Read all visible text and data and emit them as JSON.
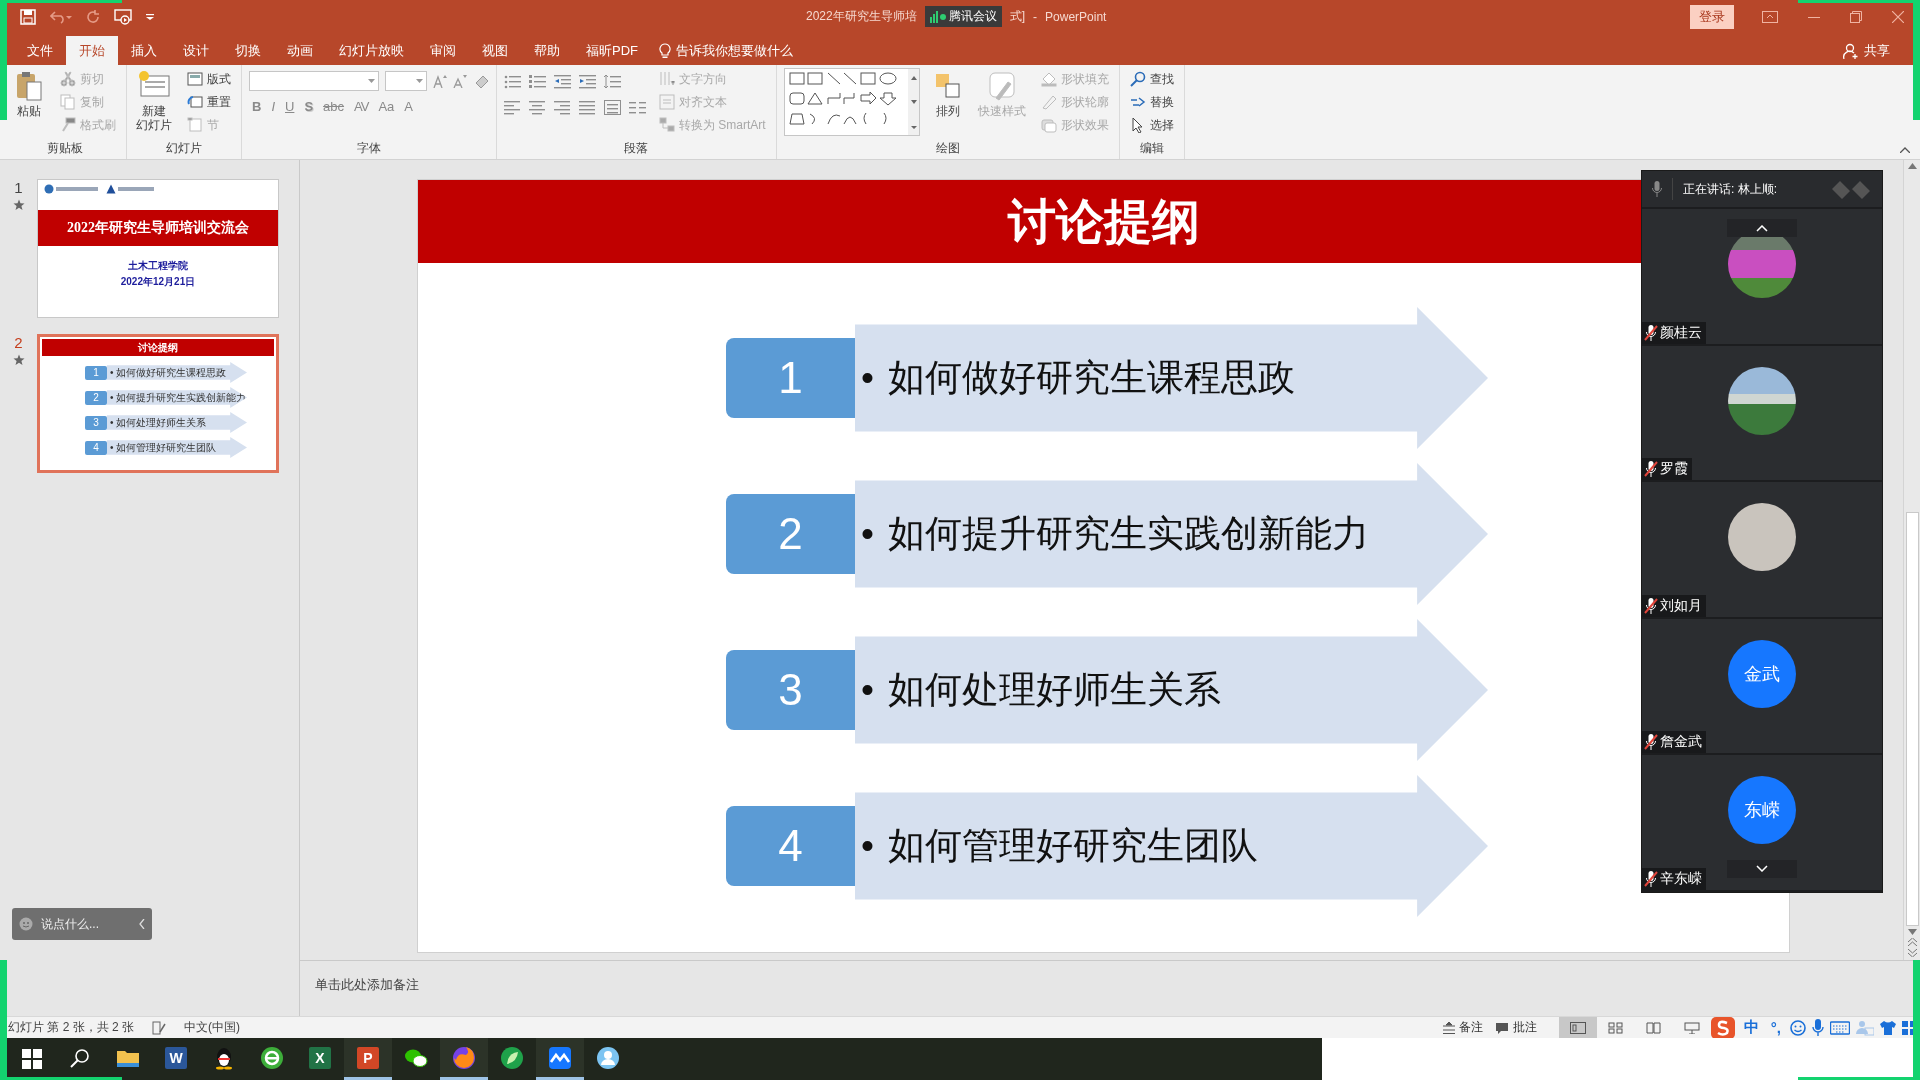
{
  "window": {
    "title": "2022年研究生导师培",
    "overlay_badge": "腾讯会议",
    "title_suffix": "式]",
    "separator": "-",
    "app_name": "PowerPoint",
    "login_button": "登录"
  },
  "menu_tabs": [
    {
      "label": "文件",
      "selected": false
    },
    {
      "label": "开始",
      "selected": true
    },
    {
      "label": "插入",
      "selected": false
    },
    {
      "label": "设计",
      "selected": false
    },
    {
      "label": "切换",
      "selected": false
    },
    {
      "label": "动画",
      "selected": false
    },
    {
      "label": "幻灯片放映",
      "selected": false
    },
    {
      "label": "审阅",
      "selected": false
    },
    {
      "label": "视图",
      "selected": false
    },
    {
      "label": "帮助",
      "selected": false
    },
    {
      "label": "福昕PDF",
      "selected": false
    }
  ],
  "tell_me": "告诉我你想要做什么",
  "share": "共享",
  "ribbon_groups": [
    {
      "kind": "clipboard",
      "label": "剪贴板",
      "large": [
        {
          "label": "粘贴",
          "disabled": false
        }
      ],
      "items": [
        {
          "label": "剪切",
          "disabled": true
        },
        {
          "label": "复制",
          "disabled": true
        },
        {
          "label": "格式刷",
          "disabled": true
        }
      ]
    },
    {
      "kind": "slides",
      "label": "幻灯片",
      "large": [
        {
          "label_lines": [
            "新建",
            "幻灯片"
          ],
          "disabled": false
        }
      ],
      "items": [
        {
          "label": "版式",
          "disabled": false
        },
        {
          "label": "重置",
          "disabled": false
        },
        {
          "label": "节",
          "disabled": true
        }
      ]
    },
    {
      "kind": "font",
      "label": "字体",
      "tools": [
        "B",
        "I",
        "U",
        "S",
        "abc",
        "AV",
        "Aa",
        "A"
      ]
    },
    {
      "kind": "paragraph",
      "label": "段落",
      "items": [
        {
          "label": "文字方向",
          "disabled": true
        },
        {
          "label": "对齐文本",
          "disabled": true
        },
        {
          "label": "转换为 SmartArt",
          "disabled": true
        }
      ]
    },
    {
      "kind": "drawing",
      "label": "绘图",
      "large": [
        {
          "label": "排列",
          "disabled": false
        },
        {
          "label": "快速样式",
          "disabled": true
        }
      ],
      "items": [
        {
          "label": "形状填充",
          "disabled": true
        },
        {
          "label": "形状轮廓",
          "disabled": true
        },
        {
          "label": "形状效果",
          "disabled": true
        }
      ]
    },
    {
      "kind": "editing",
      "label": "编辑",
      "items": [
        {
          "label": "查找",
          "disabled": false
        },
        {
          "label": "替换",
          "disabled": false
        },
        {
          "label": "选择",
          "disabled": false
        }
      ]
    }
  ],
  "thumbnails": [
    {
      "number": "1",
      "selected": false,
      "kind": "title",
      "title": "2022年研究生导师培训交流会",
      "subtitle": "土木工程学院",
      "date": "2022年12月21日"
    },
    {
      "number": "2",
      "selected": true,
      "kind": "outline",
      "title": "讨论提纲",
      "items": [
        {
          "number": "1",
          "bullet": "•",
          "text": "如何做好研究生课程思政"
        },
        {
          "number": "2",
          "bullet": "•",
          "text": "如何提升研究生实践创新能力"
        },
        {
          "number": "3",
          "bullet": "•",
          "text": "如何处理好师生关系"
        },
        {
          "number": "4",
          "bullet": "•",
          "text": "如何管理好研究生团队"
        }
      ]
    }
  ],
  "chat_chip": {
    "placeholder": "说点什么..."
  },
  "slide": {
    "title": "讨论提纲",
    "items": [
      {
        "number": "1",
        "bullet": "•",
        "text": "如何做好研究生课程思政"
      },
      {
        "number": "2",
        "bullet": "•",
        "text": "如何提升研究生实践创新能力"
      },
      {
        "number": "3",
        "bullet": "•",
        "text": "如何处理好师生关系"
      },
      {
        "number": "4",
        "bullet": "•",
        "text": "如何管理好研究生团队"
      }
    ]
  },
  "notes_placeholder": "单击此处添加备注",
  "meeting": {
    "speaking": "正在讲话: 林上顺:",
    "participants": [
      {
        "name": "颜桂云",
        "kind": "photo",
        "muted": true
      },
      {
        "name": "罗霞",
        "kind": "photo",
        "muted": true
      },
      {
        "name": "刘如月",
        "kind": "photo",
        "muted": true
      },
      {
        "name": "詹金武",
        "kind": "initials",
        "initials": "金武",
        "muted": true
      },
      {
        "name": "辛东嵘",
        "kind": "initials",
        "initials": "东嵘",
        "muted": true
      }
    ]
  },
  "status": {
    "slide_info": "幻灯片 第 2 张，共 2 张",
    "language": "中文(中国)",
    "notes_button": "备注",
    "comments_button": "批注",
    "views": [
      {
        "kind": "normal",
        "selected": true
      },
      {
        "kind": "sorter",
        "selected": false
      },
      {
        "kind": "reading",
        "selected": false
      },
      {
        "kind": "slideshow",
        "selected": false
      }
    ]
  },
  "ime": {
    "mode": "中",
    "punctuation": "°,"
  },
  "taskbar": {
    "apps": [
      {
        "kind": "start",
        "running": false
      },
      {
        "kind": "search",
        "running": false
      },
      {
        "kind": "explorer",
        "running": false
      },
      {
        "kind": "word",
        "glyph": "W",
        "running": false
      },
      {
        "kind": "qq",
        "running": false
      },
      {
        "kind": "browser",
        "running": false
      },
      {
        "kind": "excel",
        "glyph": "X",
        "running": false
      },
      {
        "kind": "powerpoint",
        "glyph": "P",
        "running": true
      },
      {
        "kind": "wechat",
        "running": false
      },
      {
        "kind": "firefox",
        "running": true
      },
      {
        "kind": "leaf",
        "running": false
      },
      {
        "kind": "meeting",
        "running": true
      },
      {
        "kind": "contacts",
        "running": false
      }
    ]
  }
}
